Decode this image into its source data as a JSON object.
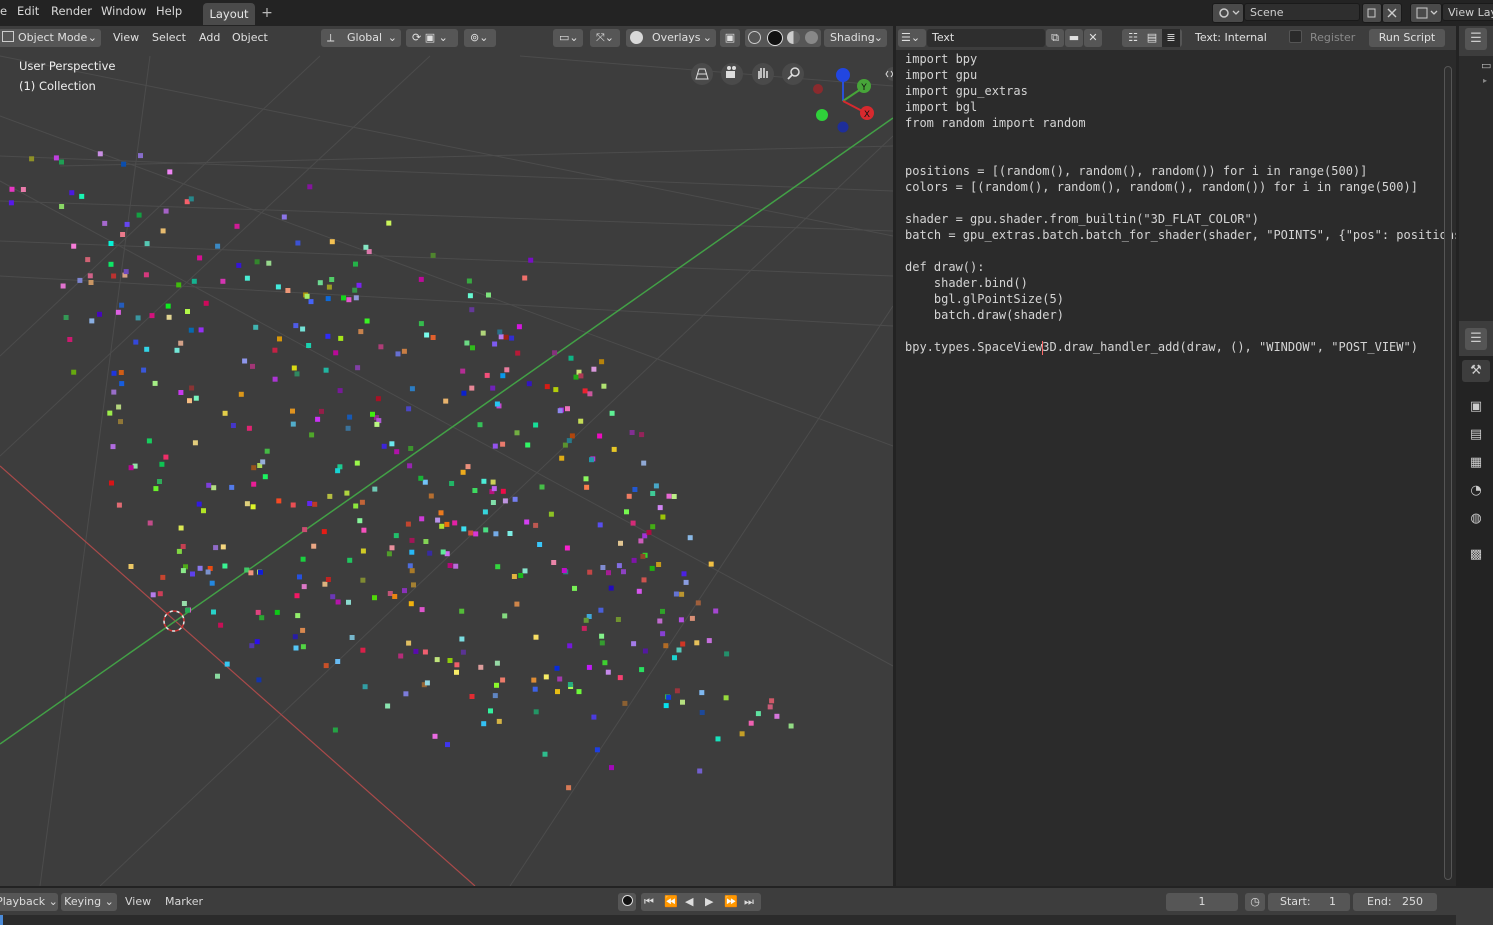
{
  "menu": {
    "partial_first": "e",
    "items": [
      "Edit",
      "Render",
      "Window",
      "Help"
    ],
    "workspace_tab": "Layout",
    "add_tab": "+",
    "scene_label": "Scene",
    "view_layer_label": "View Lay"
  },
  "viewport_header": {
    "mode": "Object Mode",
    "menus": [
      "View",
      "Select",
      "Add",
      "Object"
    ],
    "transform_orientation": "Global",
    "overlays": "Overlays",
    "shading": "Shading"
  },
  "viewport": {
    "perspective_label": "User Perspective",
    "collection_label": "(1) Collection",
    "gizmo_axes": {
      "y": "Y",
      "x": "X"
    }
  },
  "text_editor": {
    "text_name": "Text",
    "status": "Text: Internal",
    "register_label": "Register",
    "run_button": "Run Script",
    "code_lines": [
      "import bpy",
      "import gpu",
      "import gpu_extras",
      "import bgl",
      "from random import random",
      "",
      "",
      "positions = [(random(), random(), random()) for i in range(500)]",
      "colors = [(random(), random(), random(), random()) for i in range(500)]",
      "",
      "shader = gpu.shader.from_builtin(\"3D_FLAT_COLOR\")",
      "batch = gpu_extras.batch.batch_for_shader(shader, \"POINTS\", {\"pos\": positions",
      "",
      "def draw():",
      "    shader.bind()",
      "    bgl.glPointSize(5)",
      "    batch.draw(shader)",
      "",
      "bpy.types.SpaceView3D.draw_handler_add(draw, (), \"WINDOW\", \"POST_VIEW\")"
    ]
  },
  "timeline": {
    "playback": "Playback",
    "keying": "Keying",
    "view": "View",
    "marker": "Marker",
    "current_frame": "1",
    "start_label": "Start:",
    "start_value": "1",
    "end_label": "End:",
    "end_value": "250"
  },
  "colors": {
    "x_axis": "#b5494e",
    "y_axis": "#4caf50",
    "grid": "#4a4a4a",
    "gizmo_x": "#d7292e",
    "gizmo_y": "#47a539",
    "gizmo_z": "#1f4de0"
  }
}
